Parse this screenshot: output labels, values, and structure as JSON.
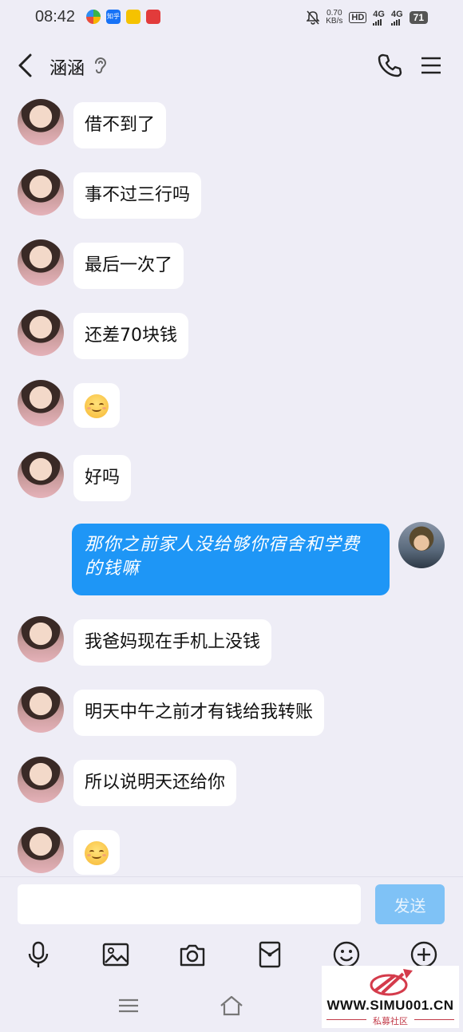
{
  "status_bar": {
    "time": "08:42",
    "net_speed_value": "0.70",
    "net_speed_unit": "KB/s",
    "hd_label": "HD",
    "hd_sub": "1",
    "hd_sub2": "2",
    "signal1": "4G",
    "signal2": "4G",
    "battery": "71",
    "app_icons": [
      "browser-icon",
      "zhihu-icon",
      "app-badge-icon",
      "red-app-icon"
    ],
    "zhihu_text": "知乎"
  },
  "header": {
    "contact_name": "涵涵",
    "icons": [
      "back-icon",
      "ear-icon",
      "phone-icon",
      "menu-icon"
    ]
  },
  "messages": [
    {
      "side": "left",
      "text": "借不到了"
    },
    {
      "side": "left",
      "text": "事不过三行吗"
    },
    {
      "side": "left",
      "text": "最后一次了"
    },
    {
      "side": "left",
      "text": "还差70块钱"
    },
    {
      "side": "left",
      "emoji": "smile-emoji"
    },
    {
      "side": "left",
      "text": "好吗"
    },
    {
      "side": "right",
      "text": "那你之前家人没给够你宿舍和学费的钱嘛"
    },
    {
      "side": "left",
      "text": "我爸妈现在手机上没钱"
    },
    {
      "side": "left",
      "text": "明天中午之前才有钱给我转账"
    },
    {
      "side": "left",
      "text": "所以说明天还给你"
    },
    {
      "side": "left",
      "emoji": "smile-emoji"
    }
  ],
  "input_bar": {
    "value": "",
    "send_label": "发送"
  },
  "toolbar": {
    "icons": [
      "microphone-icon",
      "image-icon",
      "camera-icon",
      "red-packet-icon",
      "emoji-icon",
      "plus-icon"
    ]
  },
  "nav_bar": {
    "icons": [
      "menu-nav-icon",
      "home-nav-icon"
    ]
  },
  "watermark": {
    "site": "WWW.SIMU001.CN",
    "cn": "私募社区"
  },
  "colors": {
    "background": "#eeedf6",
    "my_bubble": "#1e96f6",
    "their_bubble": "#ffffff",
    "send_button": "#7fc2f6"
  }
}
